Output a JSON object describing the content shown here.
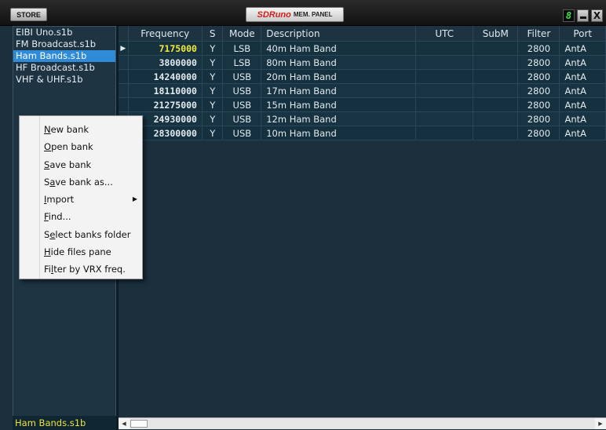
{
  "window": {
    "store_label": "STORE",
    "title_brand": "SDRuno",
    "title_text": "MEM. PANEL",
    "digit": "8",
    "close_label": "X"
  },
  "files": {
    "items": [
      {
        "label": "EIBI Uno.s1b",
        "selected": false
      },
      {
        "label": "FM Broadcast.s1b",
        "selected": false
      },
      {
        "label": "Ham Bands.s1b",
        "selected": true
      },
      {
        "label": "HF Broadcast.s1b",
        "selected": false
      },
      {
        "label": "VHF & UHF.s1b",
        "selected": false
      }
    ],
    "status": "Ham Bands.s1b"
  },
  "table": {
    "columns": [
      "Frequency",
      "S",
      "Mode",
      "Description",
      "UTC",
      "SubM",
      "Filter",
      "Port"
    ],
    "current_row": 0,
    "rows": [
      [
        "7175000",
        "Y",
        "LSB",
        "40m Ham Band",
        "",
        "",
        "2800",
        "AntA"
      ],
      [
        "3800000",
        "Y",
        "LSB",
        "80m Ham Band",
        "",
        "",
        "2800",
        "AntA"
      ],
      [
        "14240000",
        "Y",
        "USB",
        "20m Ham Band",
        "",
        "",
        "2800",
        "AntA"
      ],
      [
        "18110000",
        "Y",
        "USB",
        "17m Ham Band",
        "",
        "",
        "2800",
        "AntA"
      ],
      [
        "21275000",
        "Y",
        "USB",
        "15m Ham Band",
        "",
        "",
        "2800",
        "AntA"
      ],
      [
        "24930000",
        "Y",
        "USB",
        "12m Ham Band",
        "",
        "",
        "2800",
        "AntA"
      ],
      [
        "28300000",
        "Y",
        "USB",
        "10m Ham Band",
        "",
        "",
        "2800",
        "AntA"
      ]
    ]
  },
  "context_menu": {
    "items": [
      {
        "label": "New bank",
        "mnemonic": "N",
        "submenu": false
      },
      {
        "label": "Open bank",
        "mnemonic": "O",
        "submenu": false
      },
      {
        "label": "Save bank",
        "mnemonic": "S",
        "submenu": false
      },
      {
        "label": "Save bank as...",
        "mnemonic": "a",
        "submenu": false
      },
      {
        "label": "Import",
        "mnemonic": "I",
        "submenu": true
      },
      {
        "label": "Find...",
        "mnemonic": "F",
        "submenu": false
      },
      {
        "label": "Select banks folder",
        "mnemonic": "e",
        "submenu": false
      },
      {
        "label": "Hide files pane",
        "mnemonic": "H",
        "submenu": false
      },
      {
        "label": "Filter by VRX freq.",
        "mnemonic": "l",
        "submenu": false
      }
    ]
  },
  "colors": {
    "background": "#1b2f3d",
    "selection": "#2f8ad8",
    "current_frequency": "#f2e93a",
    "title_brand": "#d1201b"
  }
}
